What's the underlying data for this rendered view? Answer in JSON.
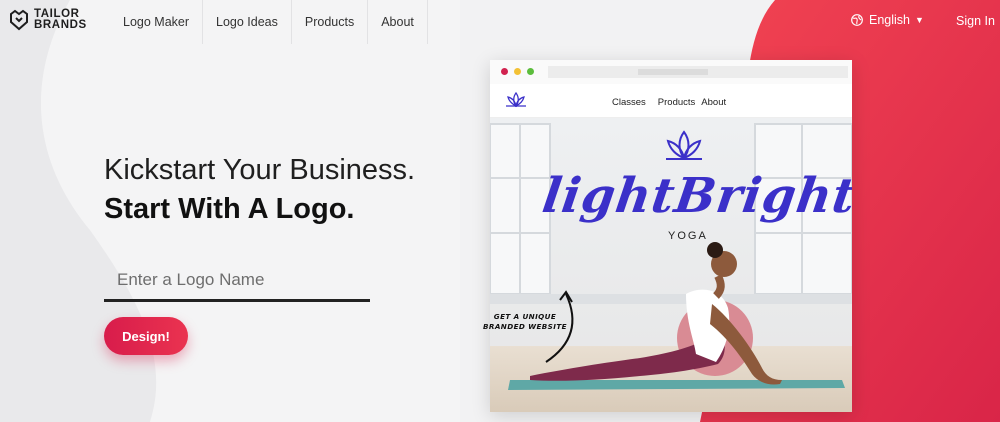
{
  "nav": {
    "brand_line1": "TAILOR",
    "brand_line2": "BRANDS",
    "links": [
      "Logo Maker",
      "Logo Ideas",
      "Products",
      "About"
    ],
    "language": "English",
    "signin": "Sign In"
  },
  "hero": {
    "headline_line1": "Kickstart Your Business.",
    "headline_line2": "Start With A Logo.",
    "input_placeholder": "Enter a Logo Name",
    "design_button": "Design!"
  },
  "mockup": {
    "nav_links": [
      "Classes",
      "Products",
      "About"
    ],
    "brand_word": "lightBright",
    "brand_sub": "YOGA",
    "callout_line1": "GET A UNIQUE",
    "callout_line2": "BRANDED WEBSITE"
  },
  "colors": {
    "accent": "#e8294a",
    "brand_blue": "#3b30c9"
  },
  "icons": {
    "globe": "globe-icon",
    "chevron": "chevron-down-icon",
    "lotus": "lotus-icon",
    "logo": "tailor-brands-logo"
  }
}
